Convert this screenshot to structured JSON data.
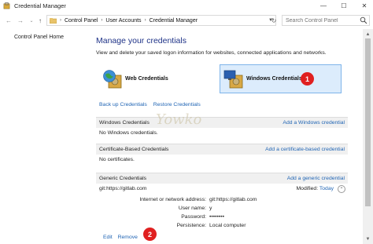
{
  "window": {
    "title": "Credential Manager",
    "minimize_glyph": "—",
    "maximize_glyph": "☐",
    "close_glyph": "✕"
  },
  "address": {
    "breadcrumbs": [
      "Control Panel",
      "User Accounts",
      "Credential Manager"
    ],
    "search_placeholder": "Search Control Panel"
  },
  "left_nav": {
    "home_label": "Control Panel Home"
  },
  "main": {
    "heading": "Manage your credentials",
    "subtext": "View and delete your saved logon information for websites, connected applications and networks.",
    "tiles": {
      "web": "Web Credentials",
      "windows": "Windows Credentials",
      "windows_badge": "1"
    },
    "links": {
      "backup": "Back up Credentials",
      "restore": "Restore Credentials"
    },
    "sections": {
      "windows": {
        "title": "Windows Credentials",
        "action": "Add a Windows credential",
        "empty": "No Windows credentials."
      },
      "certificate": {
        "title": "Certificate-Based Credentials",
        "action": "Add a certificate-based credential",
        "empty": "No certificates."
      },
      "generic": {
        "title": "Generic Credentials",
        "action": "Add a generic credential"
      }
    },
    "generic_entry": {
      "name": "git:https://gitlab.com",
      "modified_label": "Modified:",
      "modified_value": "Today",
      "fields": [
        {
          "key": "Internet or network address:",
          "value": "git:https://gitlab.com"
        },
        {
          "key": "User name:",
          "value": "y"
        },
        {
          "key": "Password:",
          "value": "••••••••"
        },
        {
          "key": "Persistence:",
          "value": "Local computer"
        }
      ],
      "edit_label": "Edit",
      "remove_label": "Remove",
      "remove_badge": "2"
    },
    "watermark": "Yowko"
  },
  "colors": {
    "heading_blue": "#1e3287",
    "link_blue": "#1f64b4",
    "tile_selected_bg": "#dcecfc",
    "tile_selected_border": "#7eb4ea",
    "badge_red": "#e02020",
    "section_bg": "#f0f0f0"
  },
  "icons": [
    "credential-manager-icon",
    "back-arrow-icon",
    "forward-arrow-icon",
    "dropdown-icon",
    "up-arrow-icon",
    "folder-icon",
    "refresh-icon",
    "search-icon",
    "globe-safe-icon",
    "monitor-safe-icon",
    "collapse-chevron-icon"
  ]
}
